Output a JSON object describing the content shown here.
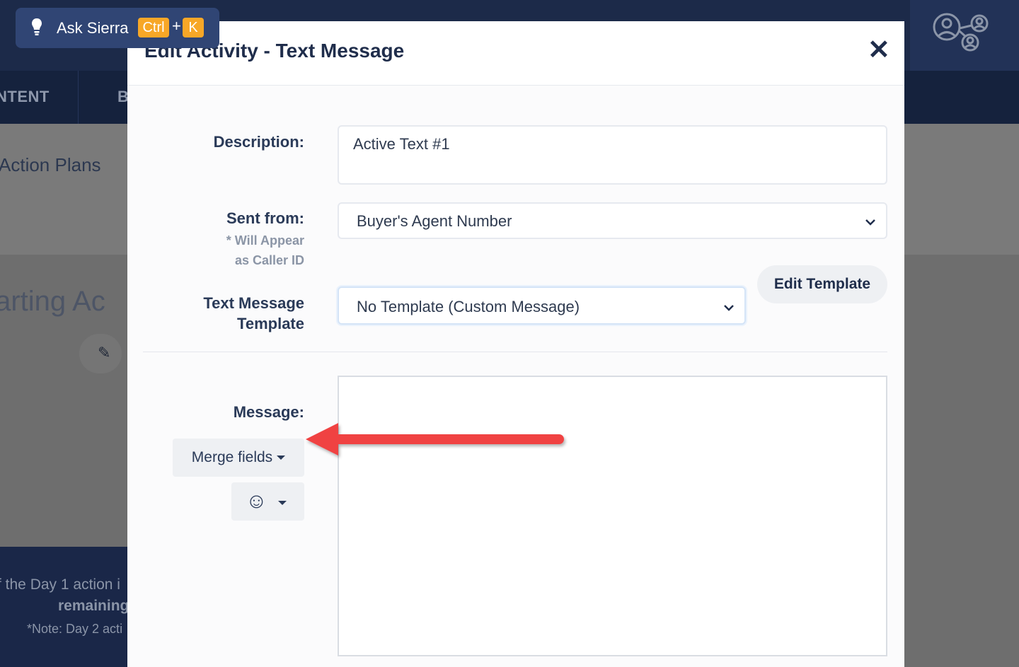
{
  "app": {
    "ask_button": {
      "label": "Ask Sierra",
      "key1": "Ctrl",
      "plus": "+",
      "key2": "K",
      "icon": "lightbulb-icon"
    },
    "nav": {
      "item_1": "NTENT",
      "item_2": "B"
    },
    "breadcrumb": "Action Plans",
    "page_heading": "tarting Ac",
    "footer": {
      "line1": "f the Day 1 action i",
      "line2": "remaining",
      "line3": "*Note: Day 2 acti"
    },
    "user_icon": "users-network-icon",
    "accent_color": "#f7a727",
    "primary_color": "#1f2d4b"
  },
  "modal": {
    "title": "Edit Activity - Text Message",
    "close_icon": "close-icon",
    "description": {
      "label": "Description:",
      "value": "Active Text #1"
    },
    "sent_from": {
      "label": "Sent from:",
      "note_line1": "* Will Appear",
      "note_line2": "as Caller ID",
      "value": "Buyer's Agent Number"
    },
    "template": {
      "label_line1": "Text Message",
      "label_line2": "Template",
      "value": "No Template (Custom Message)",
      "edit_button": "Edit Template"
    },
    "message": {
      "label": "Message:",
      "value": "",
      "merge_fields_button": "Merge fields",
      "emoji_button_icon": "smiley-icon"
    }
  },
  "annotation": {
    "arrow_color": "#f04343",
    "points_to": "merge-fields-button"
  }
}
